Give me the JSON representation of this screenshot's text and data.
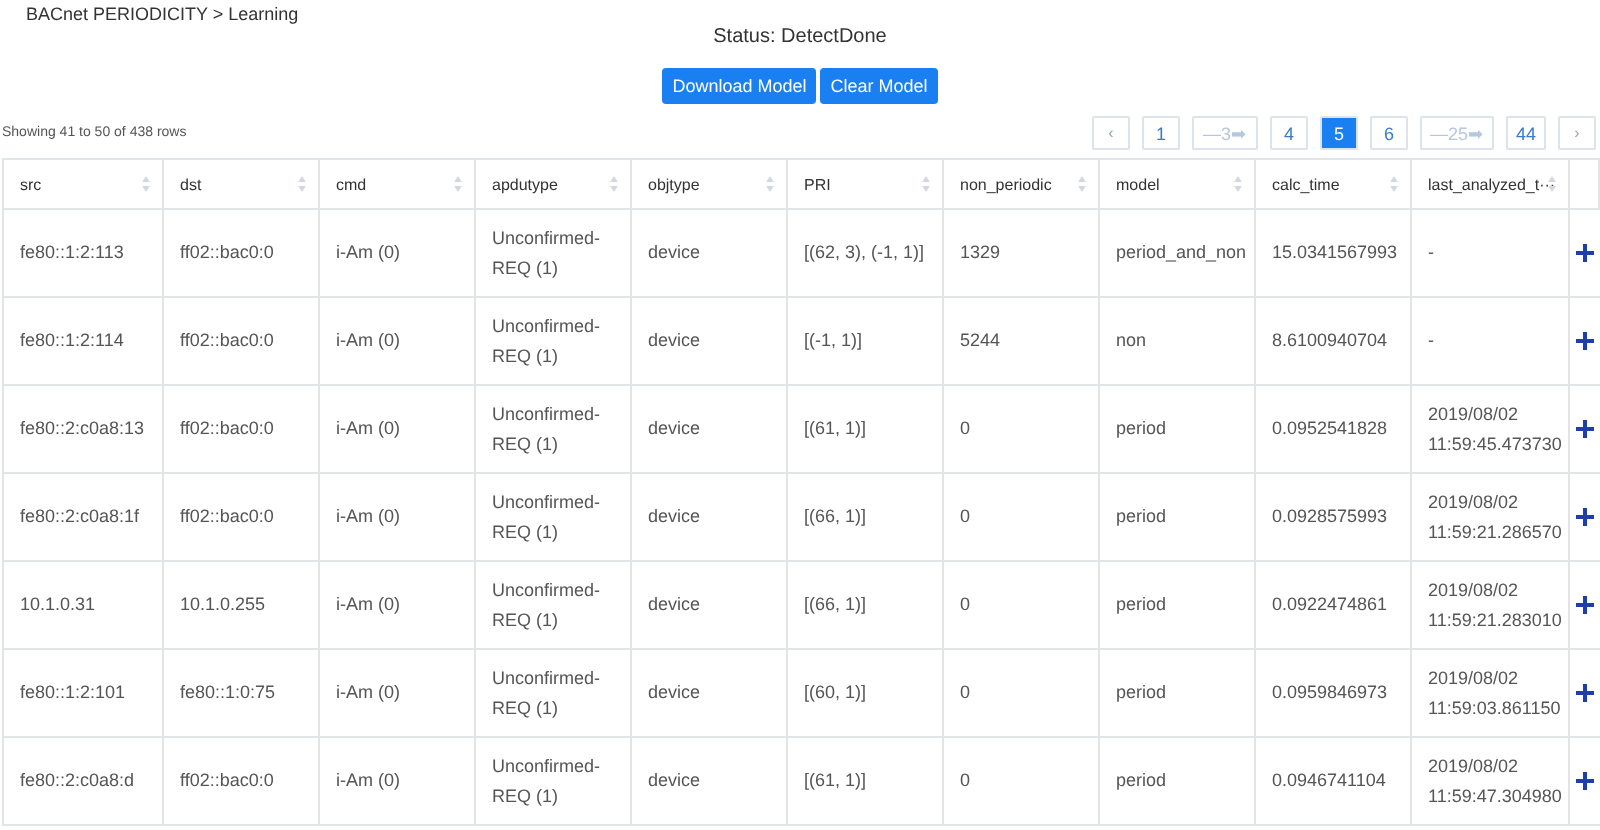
{
  "breadcrumb": "BACnet PERIODICITY > Learning",
  "status": "Status: DetectDone",
  "buttons": [
    "Download Model",
    "Clear Model"
  ],
  "summary": "Showing 41 to 50 of 438 rows",
  "pagination": [
    {
      "label": "‹",
      "kind": "arrow",
      "selected": false
    },
    {
      "label": "1",
      "kind": "page",
      "selected": false
    },
    {
      "label": "—3➡",
      "kind": "jump",
      "selected": false
    },
    {
      "label": "4",
      "kind": "page",
      "selected": false
    },
    {
      "label": "5",
      "kind": "page",
      "selected": true
    },
    {
      "label": "6",
      "kind": "page",
      "selected": false
    },
    {
      "label": "—25➡",
      "kind": "jump",
      "selected": false
    },
    {
      "label": "44",
      "kind": "page",
      "selected": false
    },
    {
      "label": "›",
      "kind": "arrow",
      "selected": false
    }
  ],
  "table": {
    "columns": [
      "src",
      "dst",
      "cmd",
      "apdutype",
      "objtype",
      "PRI",
      "non_periodic",
      "model",
      "calc_time",
      "last_analyzed_t···"
    ],
    "rows": [
      [
        "fe80::1:2:113",
        "ff02::bac0:0",
        "i-Am (0)",
        "Unconfirmed-REQ (1)",
        "device",
        "[(62, 3), (-1, 1)]",
        "1329",
        "period_and_non",
        "15.0341567993",
        "-"
      ],
      [
        "fe80::1:2:114",
        "ff02::bac0:0",
        "i-Am (0)",
        "Unconfirmed-REQ (1)",
        "device",
        "[(-1, 1)]",
        "5244",
        "non",
        "8.6100940704",
        "-"
      ],
      [
        "fe80::2:c0a8:13",
        "ff02::bac0:0",
        "i-Am (0)",
        "Unconfirmed-REQ (1)",
        "device",
        "[(61, 1)]",
        "0",
        "period",
        "0.0952541828",
        "2019/08/02 11:59:45.473730"
      ],
      [
        "fe80::2:c0a8:1f",
        "ff02::bac0:0",
        "i-Am (0)",
        "Unconfirmed-REQ (1)",
        "device",
        "[(66, 1)]",
        "0",
        "period",
        "0.0928575993",
        "2019/08/02 11:59:21.286570"
      ],
      [
        "10.1.0.31",
        "10.1.0.255",
        "i-Am (0)",
        "Unconfirmed-REQ (1)",
        "device",
        "[(66, 1)]",
        "0",
        "period",
        "0.0922474861",
        "2019/08/02 11:59:21.283010"
      ],
      [
        "fe80::1:2:101",
        "fe80::1:0:75",
        "i-Am (0)",
        "Unconfirmed-REQ (1)",
        "device",
        "[(60, 1)]",
        "0",
        "period",
        "0.0959846973",
        "2019/08/02 11:59:03.861150"
      ],
      [
        "fe80::2:c0a8:d",
        "ff02::bac0:0",
        "i-Am (0)",
        "Unconfirmed-REQ (1)",
        "device",
        "[(61, 1)]",
        "0",
        "period",
        "0.0946741104",
        "2019/08/02 11:59:47.304980"
      ]
    ]
  }
}
